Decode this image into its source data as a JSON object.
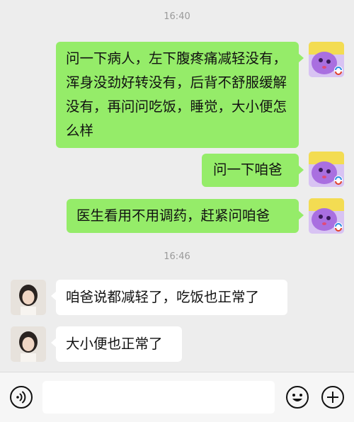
{
  "chat": {
    "timestamps": [
      "16:40",
      "16:46"
    ],
    "messages": [
      {
        "side": "out",
        "text": "问一下病人，左下腹疼痛减轻没有，浑身没劲好转没有，后背不舒服缓解没有，再问问吃饭，睡觉，大小便怎么样"
      },
      {
        "side": "out",
        "text": "问一下咱爸"
      },
      {
        "side": "out",
        "text": "医生看用不用调药，赶紧问咱爸"
      },
      {
        "side": "in",
        "text": "咱爸说都减轻了，吃饭也正常了"
      },
      {
        "side": "in",
        "text": "大小便也正常了"
      }
    ]
  },
  "input_bar": {
    "voice_icon": "voice-icon",
    "emoji_icon": "emoji-icon",
    "plus_icon": "plus-icon",
    "input_value": ""
  },
  "colors": {
    "outgoing_bubble": "#95ec69",
    "incoming_bubble": "#ffffff",
    "background": "#ededed"
  }
}
